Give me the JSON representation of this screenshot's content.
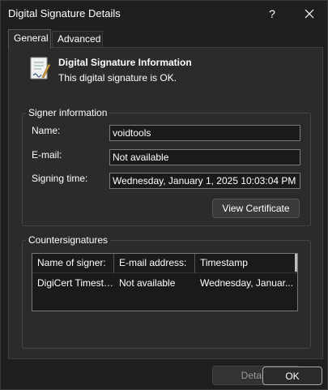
{
  "window": {
    "title": "Digital Signature Details",
    "help_label": "?"
  },
  "tabs": [
    {
      "label": "General",
      "selected": true
    },
    {
      "label": "Advanced",
      "selected": false
    }
  ],
  "header": {
    "title": "Digital Signature Information",
    "status": "This digital signature is OK."
  },
  "signer": {
    "legend": "Signer information",
    "name_label": "Name:",
    "name_value": "voidtools",
    "email_label": "E-mail:",
    "email_value": "Not available",
    "time_label": "Signing time:",
    "time_value": "Wednesday, January 1, 2025 10:03:04 PM",
    "view_cert_label": "View Certificate"
  },
  "countersignatures": {
    "legend": "Countersignatures",
    "columns": [
      "Name of signer:",
      "E-mail address:",
      "Timestamp"
    ],
    "rows": [
      [
        "DigiCert Timesta...",
        "Not available",
        "Wednesday, Januar..."
      ]
    ],
    "details_label": "Details"
  },
  "footer": {
    "ok_label": "OK"
  },
  "colors": {
    "background": "#1f1f1f",
    "panel": "#2b2b2b",
    "field": "#1a1a1a"
  }
}
